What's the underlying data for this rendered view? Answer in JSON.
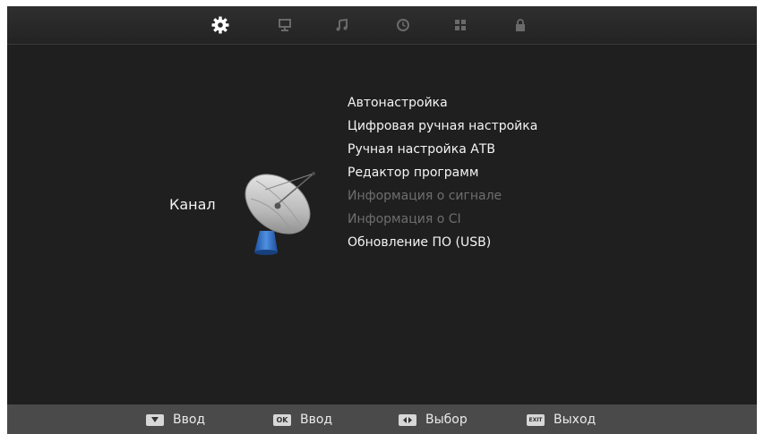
{
  "tabs": [
    {
      "icon": "gear-icon",
      "active": true
    },
    {
      "icon": "monitor-icon",
      "active": false
    },
    {
      "icon": "music-note-icon",
      "active": false
    },
    {
      "icon": "clock-icon",
      "active": false
    },
    {
      "icon": "grid-icon",
      "active": false
    },
    {
      "icon": "lock-icon",
      "active": false
    }
  ],
  "category": {
    "label": "Канал",
    "icon": "satellite-dish-icon"
  },
  "menu": {
    "items": [
      {
        "label": "Автонастройка",
        "enabled": true
      },
      {
        "label": "Цифровая ручная настройка",
        "enabled": true
      },
      {
        "label": "Ручная настройка АТВ",
        "enabled": true
      },
      {
        "label": "Редактор программ",
        "enabled": true
      },
      {
        "label": "Информация о сигнале",
        "enabled": false
      },
      {
        "label": "Информация о CI",
        "enabled": false
      },
      {
        "label": "Обновление ПО (USB)",
        "enabled": true
      }
    ]
  },
  "footer": {
    "hints": [
      {
        "key_icon": "down-arrow-key-icon",
        "key_text": "",
        "label": "Ввод"
      },
      {
        "key_icon": "ok-key-icon",
        "key_text": "OK",
        "label": "Ввод"
      },
      {
        "key_icon": "left-right-key-icon",
        "key_text": "",
        "label": "Выбор"
      },
      {
        "key_icon": "exit-key-icon",
        "key_text": "EXIT",
        "label": "Выход"
      }
    ]
  },
  "colors": {
    "background": "#1f1f1f",
    "text": "#f4f4f4",
    "disabled_text": "#6e6e6e",
    "footer": "#4a4a4a",
    "active_icon": "#ffffff",
    "inactive_icon": "#6a6a6a"
  }
}
